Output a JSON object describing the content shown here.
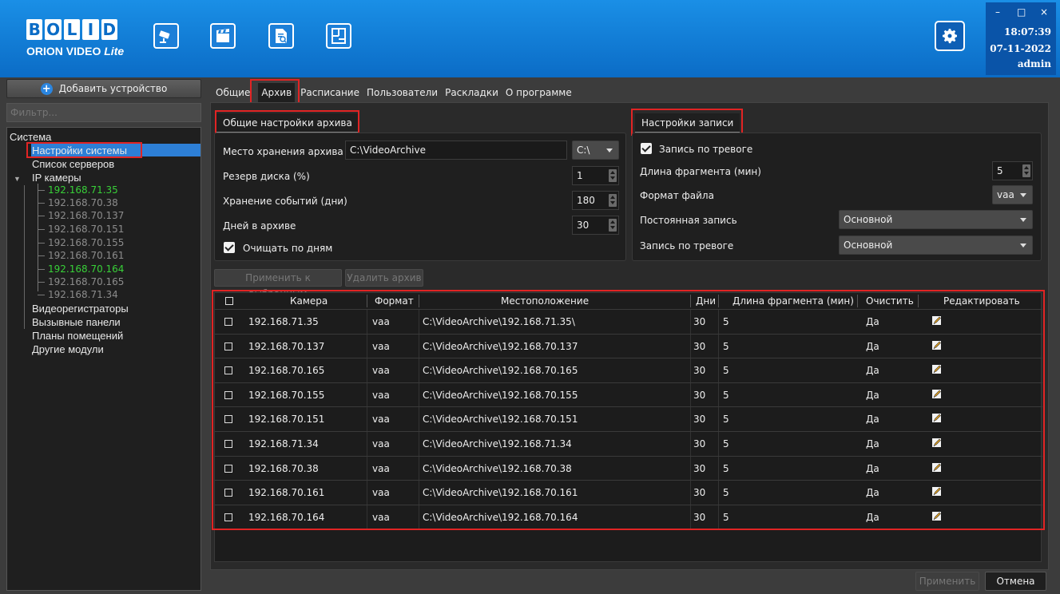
{
  "header": {
    "logo_text": "BOLID",
    "logo_subtitle": "ORION VIDEO",
    "logo_subtitle_italic": "Lite",
    "toolbar_icons": [
      "camera-icon",
      "clapperboard-icon",
      "document-search-icon",
      "layout-plan-icon"
    ],
    "clock_time": "18:07:39",
    "clock_date": "07-11-2022",
    "user": "admin",
    "window_controls": [
      "–",
      "□",
      "×"
    ]
  },
  "sidebar": {
    "add_device_label": "Добавить устройство",
    "filter_placeholder": "Фильтр...",
    "tree": {
      "root": "Система",
      "system_settings": "Настройки системы",
      "server_list": "Список серверов",
      "ip_cameras": "IP камеры",
      "cameras": [
        {
          "ip": "192.168.71.35",
          "online": true
        },
        {
          "ip": "192.168.70.38",
          "online": false
        },
        {
          "ip": "192.168.70.137",
          "online": false
        },
        {
          "ip": "192.168.70.151",
          "online": false
        },
        {
          "ip": "192.168.70.155",
          "online": false
        },
        {
          "ip": "192.168.70.161",
          "online": false
        },
        {
          "ip": "192.168.70.164",
          "online": true
        },
        {
          "ip": "192.168.70.165",
          "online": false
        },
        {
          "ip": "192.168.71.34",
          "online": false
        }
      ],
      "dvr": "Видеорегистраторы",
      "call_panels": "Вызывные панели",
      "floor_plans": "Планы помещений",
      "other_modules": "Другие модули"
    }
  },
  "tabs": [
    "Общие",
    "Архив",
    "Расписание",
    "Пользователи",
    "Раскладки",
    "О программе"
  ],
  "archive_general": {
    "title": "Общие настройки архива",
    "storage_label": "Место хранения архива",
    "storage_value": "C:\\VideoArchive",
    "drive_value": "C:\\",
    "reserve_label": "Резерв диска (%)",
    "reserve_value": "1",
    "events_label": "Хранение событий (дни)",
    "events_value": "180",
    "days_label": "Дней в архиве",
    "days_value": "30",
    "clean_label": "Очищать по дням"
  },
  "record_settings": {
    "title": "Настройки записи",
    "alarm_record_check_label": "Запись по тревоге",
    "fragment_label": "Длина фрагмента (мин)",
    "fragment_value": "5",
    "format_label": "Формат файла",
    "format_value": "vaa",
    "constant_label": "Постоянная запись",
    "constant_value": "Основной",
    "alarm_label": "Запись по тревоге",
    "alarm_value": "Основной"
  },
  "buttons": {
    "apply_selected": "Применить к выбранным",
    "delete_archive": "Удалить архив",
    "apply": "Применить",
    "cancel": "Отмена"
  },
  "table": {
    "columns": [
      "Камера",
      "Формат",
      "Местоположение",
      "Дни",
      "Длина фрагмента (мин)",
      "Очистить",
      "Редактировать"
    ],
    "rows": [
      {
        "camera": "192.168.71.35",
        "format": "vaa",
        "location": "C:\\VideoArchive\\192.168.71.35\\",
        "days": "30",
        "fragment": "5",
        "clean": "Да"
      },
      {
        "camera": "192.168.70.137",
        "format": "vaa",
        "location": "C:\\VideoArchive\\192.168.70.137",
        "days": "30",
        "fragment": "5",
        "clean": "Да"
      },
      {
        "camera": "192.168.70.165",
        "format": "vaa",
        "location": "C:\\VideoArchive\\192.168.70.165",
        "days": "30",
        "fragment": "5",
        "clean": "Да"
      },
      {
        "camera": "192.168.70.155",
        "format": "vaa",
        "location": "C:\\VideoArchive\\192.168.70.155",
        "days": "30",
        "fragment": "5",
        "clean": "Да"
      },
      {
        "camera": "192.168.70.151",
        "format": "vaa",
        "location": "C:\\VideoArchive\\192.168.70.151",
        "days": "30",
        "fragment": "5",
        "clean": "Да"
      },
      {
        "camera": "192.168.71.34",
        "format": "vaa",
        "location": "C:\\VideoArchive\\192.168.71.34",
        "days": "30",
        "fragment": "5",
        "clean": "Да"
      },
      {
        "camera": "192.168.70.38",
        "format": "vaa",
        "location": "C:\\VideoArchive\\192.168.70.38",
        "days": "30",
        "fragment": "5",
        "clean": "Да"
      },
      {
        "camera": "192.168.70.161",
        "format": "vaa",
        "location": "C:\\VideoArchive\\192.168.70.161",
        "days": "30",
        "fragment": "5",
        "clean": "Да"
      },
      {
        "camera": "192.168.70.164",
        "format": "vaa",
        "location": "C:\\VideoArchive\\192.168.70.164",
        "days": "30",
        "fragment": "5",
        "clean": "Да"
      }
    ]
  },
  "colors": {
    "header_blue": "#0b6cc6",
    "selection_blue": "#2d7fd6",
    "online_green": "#38d038",
    "highlight_red": "#e12424"
  }
}
